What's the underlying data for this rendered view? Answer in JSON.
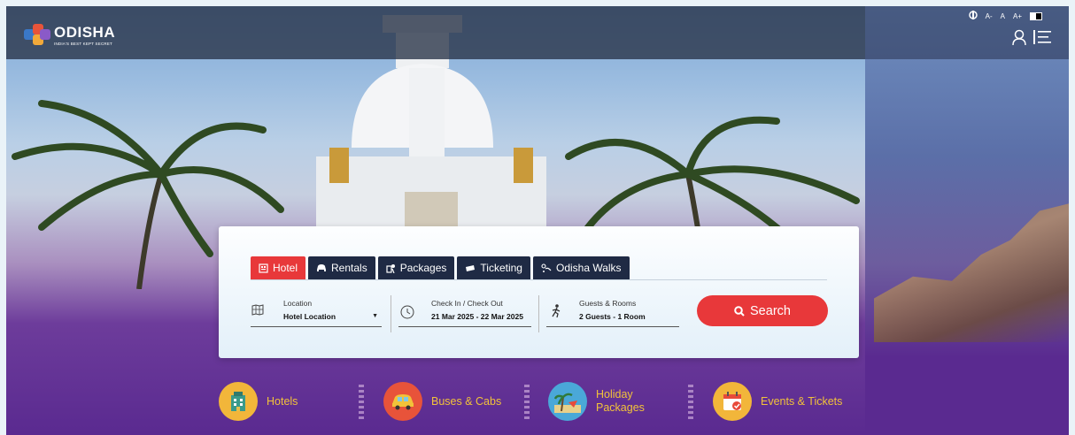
{
  "brand": {
    "name": "ODISHA",
    "tagline": "INDIA'S BEST KEPT SECRET",
    "colors": {
      "accent_red": "#e8383a",
      "navy": "#1f2a44",
      "gold": "#f2c23a",
      "purple": "#5a2a90"
    }
  },
  "accessibility": {
    "screen_reader_icon": "screen-reader-icon",
    "font_smaller": "A-",
    "font_normal": "A",
    "font_larger": "A+",
    "contrast_icon": "contrast-toggle-icon"
  },
  "header": {
    "user_icon": "user-icon",
    "menu_icon": "hamburger-menu-icon"
  },
  "tabs": [
    {
      "label": "Hotel",
      "icon": "hotel-icon",
      "active": true
    },
    {
      "label": "Rentals",
      "icon": "car-icon",
      "active": false
    },
    {
      "label": "Packages",
      "icon": "packages-icon",
      "active": false
    },
    {
      "label": "Ticketing",
      "icon": "ticket-icon",
      "active": false
    },
    {
      "label": "Odisha Walks",
      "icon": "walks-icon",
      "active": false
    }
  ],
  "search": {
    "location": {
      "label": "Location",
      "value": "Hotel Location",
      "icon": "map-icon"
    },
    "dates": {
      "label": "Check In / Check Out",
      "value": "21 Mar 2025 - 22 Mar 2025",
      "icon": "clock-icon"
    },
    "guests": {
      "label": "Guests & Rooms",
      "value": "2 Guests - 1 Room",
      "icon": "walking-person-icon"
    },
    "button_label": "Search"
  },
  "categories": [
    {
      "label": "Hotels",
      "icon": "hotel-building-icon"
    },
    {
      "label": "Buses & Cabs",
      "icon": "car-icon"
    },
    {
      "label": "Holiday Packages",
      "icon": "beach-icon"
    },
    {
      "label": "Events & Tickets",
      "icon": "calendar-icon"
    }
  ]
}
